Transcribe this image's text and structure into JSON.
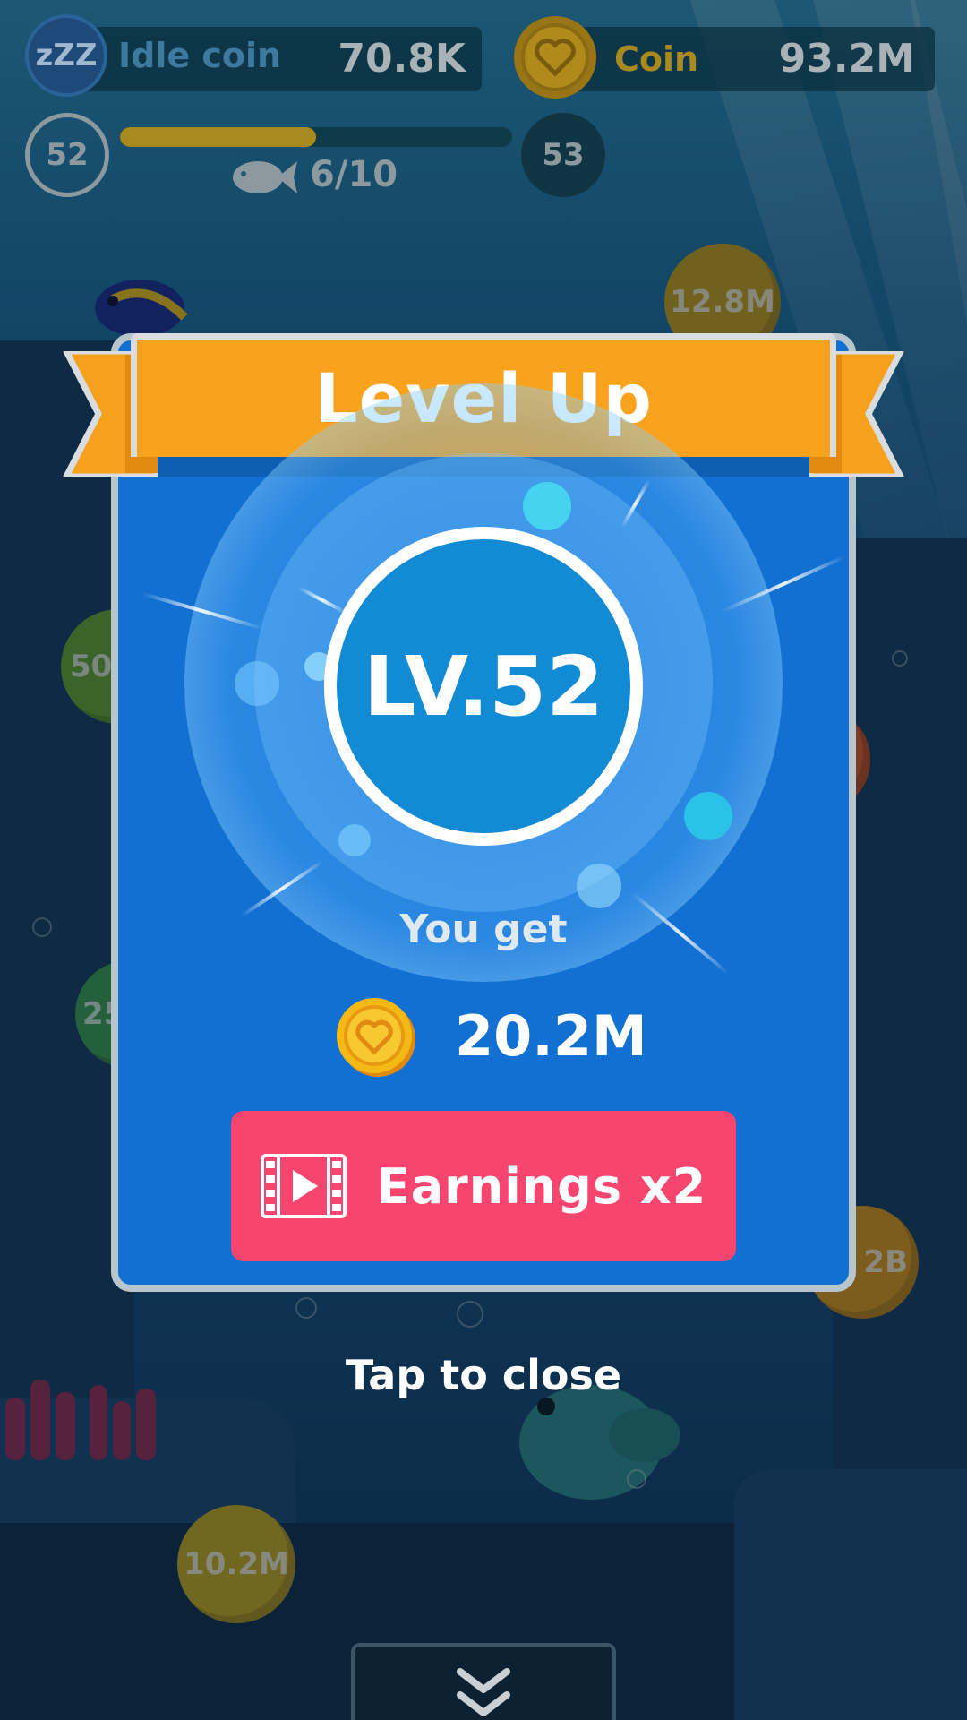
{
  "hud": {
    "idle_coin_label": "Idle coin",
    "idle_coin_value": "70.8K",
    "coin_label": "Coin",
    "coin_value": "93.2M",
    "current_level": "52",
    "next_level": "53",
    "fish_progress": "6/10",
    "level_progress_fraction": 0.5
  },
  "background": {
    "coins": [
      "12.8M",
      "50",
      "25",
      "2B",
      "10.2M"
    ]
  },
  "popup": {
    "title": "Level Up",
    "level_badge": "LV.52",
    "reward_caption": "You get",
    "reward_amount": "20.2M",
    "earnings_button_label": "Earnings x2"
  },
  "footer": {
    "tap_to_close": "Tap to close"
  },
  "colors": {
    "panel_blue": "#1270d2",
    "ribbon_orange": "#f8a21e",
    "button_pink": "#f6466f",
    "coin_gold": "#f5b916"
  },
  "icons": {
    "idle": "zzz-sleep-icon",
    "coin": "heart-coin-icon",
    "fish": "fish-icon",
    "video": "video-play-icon",
    "collapse": "double-chevron-down-icon"
  }
}
